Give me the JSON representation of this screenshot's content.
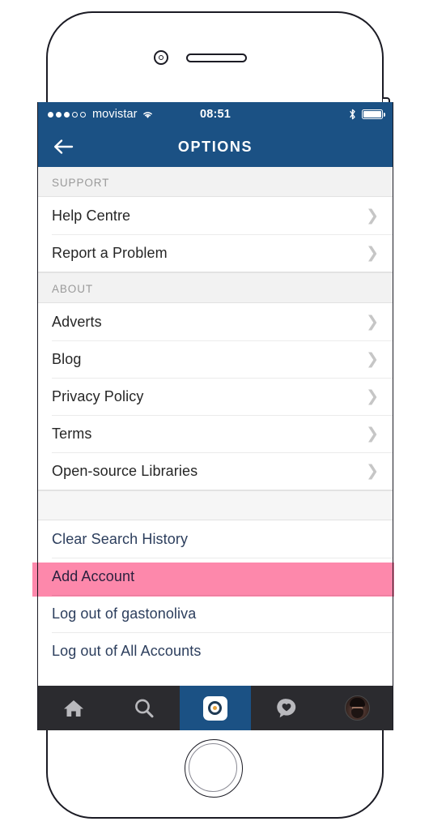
{
  "device": {
    "name": "iphone-illustration",
    "front_camera": "camera-icon",
    "speaker": "speaker-slot",
    "home_button": "home-button"
  },
  "status_bar": {
    "carrier": "movistar",
    "signal_bars_filled": 3,
    "signal_bars_total": 5,
    "wifi_icon": "wifi-icon",
    "time": "08:51",
    "bluetooth_icon": "bluetooth-icon",
    "battery_icon": "battery-full-icon",
    "battery_level": 100
  },
  "navbar": {
    "back_icon": "arrow-left-icon",
    "title": "OPTIONS"
  },
  "sections": [
    {
      "header": "SUPPORT",
      "rows": [
        {
          "label": "Help Centre",
          "chevron": "chevron-right-icon"
        },
        {
          "label": "Report a Problem",
          "chevron": "chevron-right-icon"
        }
      ]
    },
    {
      "header": "ABOUT",
      "rows": [
        {
          "label": "Adverts",
          "chevron": "chevron-right-icon"
        },
        {
          "label": "Blog",
          "chevron": "chevron-right-icon"
        },
        {
          "label": "Privacy Policy",
          "chevron": "chevron-right-icon"
        },
        {
          "label": "Terms",
          "chevron": "chevron-right-icon"
        },
        {
          "label": "Open-source Libraries",
          "chevron": "chevron-right-icon"
        }
      ]
    }
  ],
  "actions": [
    {
      "label": "Clear Search History",
      "highlighted": false
    },
    {
      "label": "Add Account",
      "highlighted": true
    },
    {
      "label": "Log out of gastonoliva",
      "highlighted": false
    },
    {
      "label": "Log out of All Accounts",
      "highlighted": false
    }
  ],
  "tabbar": {
    "items": [
      {
        "icon": "home-icon",
        "active": false
      },
      {
        "icon": "search-icon",
        "active": false
      },
      {
        "icon": "camera-icon",
        "active": true
      },
      {
        "icon": "activity-heart-icon",
        "active": false
      },
      {
        "icon": "profile-avatar-icon",
        "active": false
      }
    ]
  },
  "highlight": {
    "target": "Add Account",
    "color": "#fd88ab"
  },
  "colors": {
    "nav_blue": "#1b5184",
    "tabbar_dark": "#2b2b2f",
    "link_navy": "#2c3e5d",
    "row_text": "#262626",
    "section_header_text": "#9a9a9a",
    "section_header_bg": "#f2f2f2",
    "chevron": "#c6c6c6",
    "highlight_pink": "#fd88ab"
  }
}
